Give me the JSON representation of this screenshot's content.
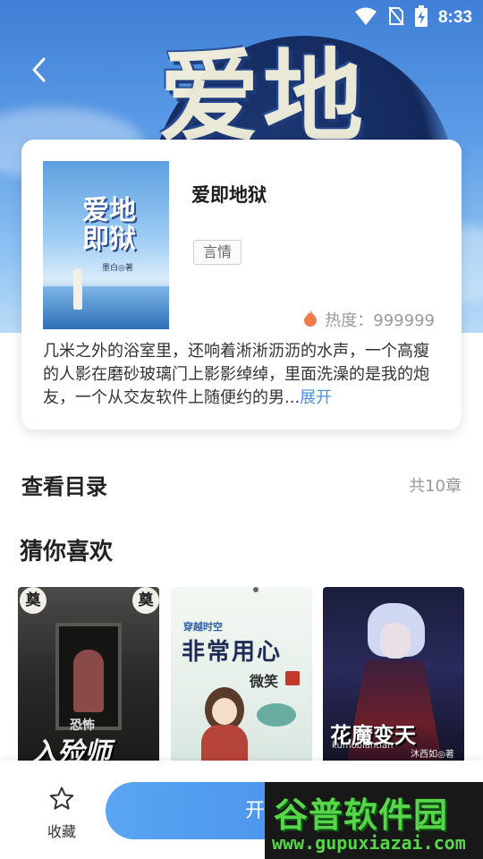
{
  "status_bar": {
    "time": "8:33"
  },
  "hero": {
    "background_title": "爱地"
  },
  "book": {
    "cover_title": "爱地即狱",
    "cover_author": "墨白◎著",
    "title": "爱即地狱",
    "genre": "言情",
    "heat_label": "热度：999999",
    "intro": "几米之外的浴室里，还响着淅淅沥沥的水声，一个高瘦的人影在磨砂玻璃门上影影绰绰，里面洗澡的是我的炮友，一个从交友软件上随便约的男...",
    "intro_more": "展开"
  },
  "catalog": {
    "label": "查看目录",
    "count": "共10章"
  },
  "recommendations": {
    "title": "猜你喜欢",
    "items": [
      {
        "badge_left": "奠",
        "badge_right": "奠",
        "small_title": "恐怖",
        "title": "入殓师"
      },
      {
        "subtitle": "穿越时空",
        "title": "非常用心",
        "author": "微笑"
      },
      {
        "title": "花魔变天",
        "subtitle": "kumobiantian",
        "author": "沐西如◎著"
      }
    ]
  },
  "bottom_bar": {
    "favorite_label": "收藏",
    "read_label": "开"
  },
  "watermark": {
    "main": "谷普软件园",
    "url": "www.gupuxiazai.com"
  },
  "colors": {
    "accent": "#4a90e2",
    "button_start": "#5aa5f3",
    "button_end": "#3b82e6",
    "heat_icon": "#f07a4a",
    "watermark_green": "#57d64a"
  },
  "icons": {
    "wifi": "wifi-icon",
    "no_sim": "no-sim-icon",
    "battery": "battery-charging-icon",
    "back": "chevron-left-icon",
    "flame": "flame-icon",
    "star": "star-outline-icon"
  }
}
